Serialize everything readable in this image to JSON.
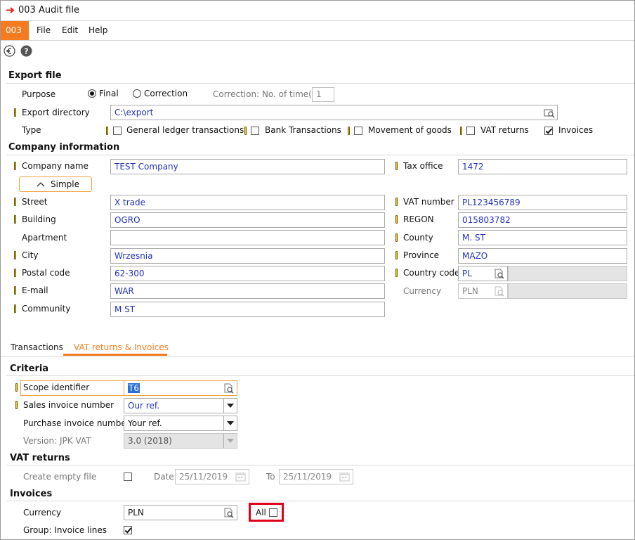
{
  "window": {
    "title": "003 Audit file"
  },
  "menubar": {
    "badge": "003",
    "items": [
      "File",
      "Edit",
      "Help"
    ]
  },
  "toolbar": {
    "icons": [
      "euro-icon",
      "help-icon"
    ]
  },
  "export": {
    "section_title": "Export file",
    "purpose_label": "Purpose",
    "radio_final": "Final",
    "radio_correction": "Correction",
    "radio_selected": "Final",
    "correction_label": "Correction: No. of time(s)",
    "correction_value": "1",
    "directory_label": "Export directory",
    "directory_value": "C:\\export",
    "type_label": "Type",
    "types": [
      {
        "label": "General ledger transactions",
        "checked": false
      },
      {
        "label": "Bank Transactions",
        "checked": false
      },
      {
        "label": "Movement of goods",
        "checked": false
      },
      {
        "label": "VAT returns",
        "checked": false
      },
      {
        "label": "Invoices",
        "checked": true
      }
    ]
  },
  "company": {
    "section_title": "Company information",
    "simple_button": "Simple",
    "left": [
      {
        "label": "Company name",
        "value": "TEST Company"
      },
      {
        "label": "Street",
        "value": "X trade"
      },
      {
        "label": "Building",
        "value": "OGRO"
      },
      {
        "label": "Apartment",
        "value": ""
      },
      {
        "label": "City",
        "value": "Wrzesnia"
      },
      {
        "label": "Postal code",
        "value": "62-300"
      },
      {
        "label": "E-mail",
        "value": "WAR"
      },
      {
        "label": "Community",
        "value": "M ST"
      }
    ],
    "right": [
      {
        "label": "Tax office",
        "value": "1472"
      },
      {
        "label": "VAT number",
        "value": "PL123456789"
      },
      {
        "label": "REGON",
        "value": "015803782"
      },
      {
        "label": "County",
        "value": "M. ST"
      },
      {
        "label": "Province",
        "value": "MAZO"
      },
      {
        "label": "Country code",
        "value": "PL"
      },
      {
        "label": "Currency",
        "value": "PLN"
      }
    ]
  },
  "tabs": [
    "Transactions",
    "VAT returns & Invoices"
  ],
  "tabs_active": "VAT returns & Invoices",
  "criteria": {
    "section_title": "Criteria",
    "scope_label": "Scope identifier",
    "scope_value": "T6",
    "sales_label": "Sales invoice number",
    "sales_value": "Our ref.",
    "purchase_label": "Purchase invoice number",
    "purchase_value": "Your ref.",
    "version_label": "Version: JPK VAT",
    "version_value": "3.0 (2018)"
  },
  "vat_returns": {
    "section_title": "VAT returns",
    "empty_file_label": "Create empty file",
    "date_label": "Date",
    "date_value": "25/11/2019",
    "to_label": "To",
    "to_value": "25/11/2019"
  },
  "invoices": {
    "section_title": "Invoices",
    "currency_label": "Currency",
    "currency_value": "PLN",
    "all_label": "All",
    "group_label": "Group: Invoice lines",
    "group_checked": true
  },
  "colors": {
    "accent": "#f47b20",
    "field_text": "#2233bb",
    "highlight": "#e0001a",
    "marker": "#f0c419"
  }
}
